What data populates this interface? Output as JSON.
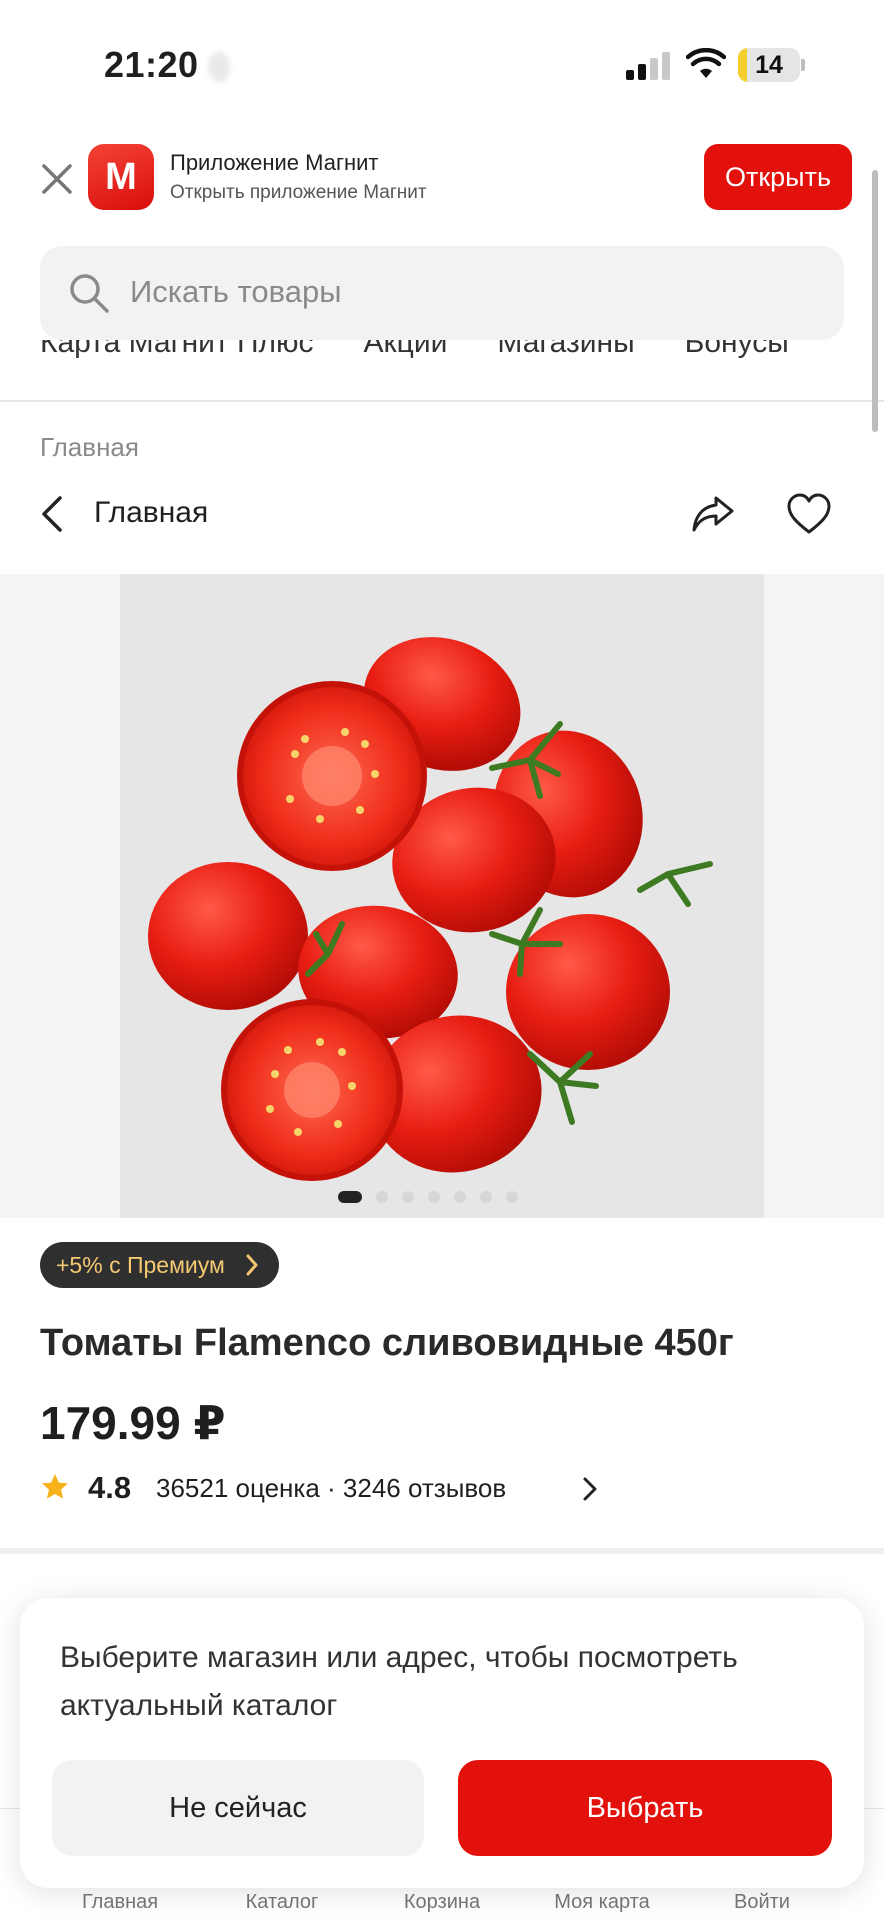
{
  "status_bar": {
    "time": "21:20",
    "battery_level": "14"
  },
  "banner": {
    "logo_letter": "M",
    "app_name": "Приложение Магнит",
    "app_subtitle": "Открыть приложение Магнит",
    "open_label": "Открыть"
  },
  "search": {
    "placeholder": "Искать товары"
  },
  "categories": [
    "Карта Магнит Плюс",
    "Акции",
    "Магазины",
    "Бонусы"
  ],
  "breadcrumb": "Главная",
  "nav": {
    "back_title": "Главная"
  },
  "gallery": {
    "total_images": 7,
    "active_index": 0
  },
  "product": {
    "premium_badge": "+5% с Премиум",
    "title": "Томаты Flamenco сливовидные 450г",
    "price": "179.99 ₽",
    "rating": "4.8",
    "rating_counts": "36521 оценка · 3246 отзывов"
  },
  "tabbar": [
    "Главная",
    "Каталог",
    "Корзина",
    "Моя карта",
    "Войти"
  ],
  "sheet": {
    "message": "Выберите магазин или адрес, чтобы посмотреть актуальный каталог",
    "later_label": "Не сейчас",
    "choose_label": "Выбрать"
  },
  "colors": {
    "brand_red": "#e3110b",
    "premium_gold": "#f5c872"
  }
}
